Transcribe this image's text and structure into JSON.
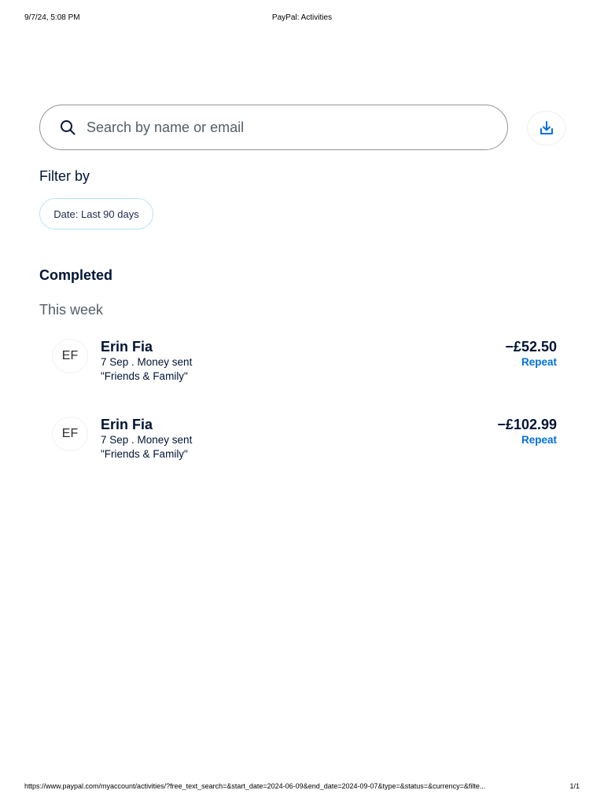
{
  "print": {
    "datetime": "9/7/24, 5:08 PM",
    "title": "PayPal: Activities",
    "url": "https://www.paypal.com/myaccount/activities/?free_text_search=&start_date=2024-06-09&end_date=2024-09-07&type=&status=&currency=&filte...",
    "page": "1/1"
  },
  "search": {
    "placeholder": "Search by name or email",
    "icon": "search-icon"
  },
  "download": {
    "icon": "download-icon"
  },
  "filter": {
    "title": "Filter by",
    "chip_label": "Date: Last 90 days"
  },
  "completed": {
    "title": "Completed",
    "group_title": "This week",
    "transactions": [
      {
        "initials": "EF",
        "name": "Erin Fia",
        "subtitle": "7 Sep . Money sent",
        "note": "\"Friends & Family\"",
        "amount": "−£52.50",
        "action": "Repeat"
      },
      {
        "initials": "EF",
        "name": "Erin Fia",
        "subtitle": "7 Sep . Money sent",
        "note": "\"Friends & Family\"",
        "amount": "−£102.99",
        "action": "Repeat"
      }
    ]
  },
  "colors": {
    "text_primary": "#001435",
    "text_secondary": "#545d68",
    "link": "#0070e0",
    "chip_border": "#b7e3f5"
  }
}
